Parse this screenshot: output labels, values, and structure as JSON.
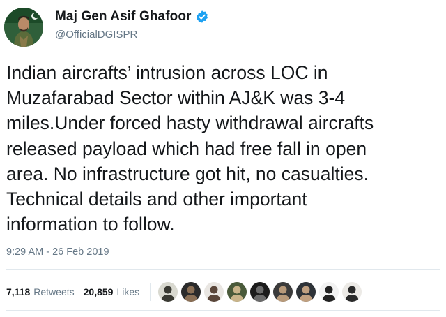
{
  "author": {
    "display_name": "Maj Gen Asif Ghafoor",
    "handle": "@OfficialDGISPR",
    "verified": true,
    "avatar_icon": "profile-photo-uniform"
  },
  "tweet": {
    "text": "Indian aircrafts’ intrusion across LOC in\nMuzafarabad Sector within AJ&K was 3-4\nmiles.Under forced hasty withdrawal aircrafts\nreleased payload which had free fall in open\narea. No infrastructure got hit, no casualties.\nTechnical details and other important\ninformation to follow.",
    "timestamp": "9:29 AM - 26 Feb 2019"
  },
  "stats": {
    "retweets_count": "7,118",
    "retweets_label": "Retweets",
    "likes_count": "20,859",
    "likes_label": "Likes"
  },
  "likers": [
    {
      "name": "liker-avatar-1",
      "bg": "#d9d9d0",
      "fg": "#3a3a33"
    },
    {
      "name": "liker-avatar-2",
      "bg": "#2b2b2b",
      "fg": "#8a6f55"
    },
    {
      "name": "liker-avatar-3",
      "bg": "#e9e6e2",
      "fg": "#5a463a"
    },
    {
      "name": "liker-avatar-4",
      "bg": "#4a5a3a",
      "fg": "#c9b48a"
    },
    {
      "name": "liker-avatar-5",
      "bg": "#1c1c1c",
      "fg": "#6b6b6b"
    },
    {
      "name": "liker-avatar-6",
      "bg": "#3b3b3b",
      "fg": "#b89a7a"
    },
    {
      "name": "liker-avatar-7",
      "bg": "#2e3338",
      "fg": "#c0a080"
    },
    {
      "name": "liker-avatar-8",
      "bg": "#f2f2f2",
      "fg": "#222222"
    },
    {
      "name": "liker-avatar-9",
      "bg": "#eceae6",
      "fg": "#2a2a2a"
    }
  ],
  "colors": {
    "text": "#14171a",
    "secondary": "#657786",
    "verified_blue": "#1da1f2",
    "divider": "#e1e8ed"
  }
}
